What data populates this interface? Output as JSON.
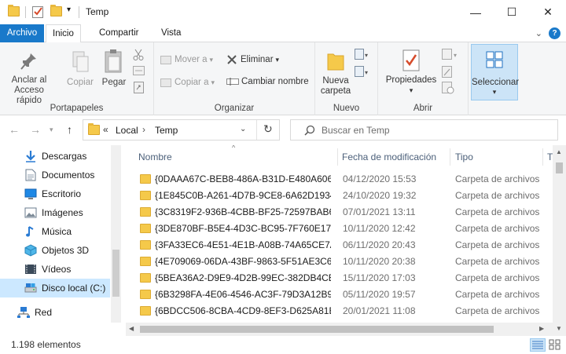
{
  "window": {
    "title": "Temp",
    "minimize": "—",
    "maximize": "☐",
    "close": "✕"
  },
  "quick_access": {
    "dropdown": "▾"
  },
  "tabs": [
    {
      "label": "Archivo"
    },
    {
      "label": "Inicio"
    },
    {
      "label": "Compartir"
    },
    {
      "label": "Vista"
    }
  ],
  "tabs_right": {
    "collapse": "⌄",
    "help": "?"
  },
  "ribbon": {
    "portapapeles": {
      "label": "Portapapeles",
      "anclar": "Anclar al",
      "anclar2": "Acceso rápido",
      "copiar": "Copiar",
      "pegar": "Pegar"
    },
    "organizar": {
      "label": "Organizar",
      "mover": "Mover a",
      "copiar_a": "Copiar a",
      "eliminar": "Eliminar",
      "cambiar": "Cambiar nombre"
    },
    "nuevo": {
      "label": "Nuevo",
      "nueva": "Nueva",
      "carpeta": "carpeta"
    },
    "abrir": {
      "label": "Abrir",
      "propiedades": "Propiedades"
    },
    "seleccionar": {
      "label": "Seleccionar"
    }
  },
  "address": {
    "breadcrumb_prefix": "«",
    "crumb1": "Local",
    "sep": "›",
    "crumb2": "Temp",
    "search_placeholder": "Buscar en Temp"
  },
  "nav": [
    {
      "label": "Descargas",
      "icon": "download-icon"
    },
    {
      "label": "Documentos",
      "icon": "document-icon"
    },
    {
      "label": "Escritorio",
      "icon": "desktop-icon"
    },
    {
      "label": "Imágenes",
      "icon": "image-icon"
    },
    {
      "label": "Música",
      "icon": "music-icon"
    },
    {
      "label": "Objetos 3D",
      "icon": "cube-icon"
    },
    {
      "label": "Vídeos",
      "icon": "video-icon"
    },
    {
      "label": "Disco local (C:)",
      "icon": "drive-icon",
      "selected": true
    },
    {
      "label": "Red",
      "icon": "network-icon"
    }
  ],
  "columns": {
    "name": "Nombre",
    "date": "Fecha de modificación",
    "type": "Tipo",
    "extra": "T"
  },
  "files": [
    {
      "name": "{0DAAA67C-BEB8-486A-B31D-E480A6068",
      "date": "04/12/2020 15:53",
      "type": "Carpeta de archivos"
    },
    {
      "name": "{1E845C0B-A261-4D7B-9CE8-6A62D1934",
      "date": "24/10/2020 19:32",
      "type": "Carpeta de archivos"
    },
    {
      "name": "{3C8319F2-936B-4CBB-BF25-72597BAB6",
      "date": "07/01/2021 13:11",
      "type": "Carpeta de archivos"
    },
    {
      "name": "{3DE870BF-B5E4-4D3C-BC95-7F760E173B",
      "date": "10/11/2020 12:42",
      "type": "Carpeta de archivos"
    },
    {
      "name": "{3FA33EC6-4E51-4E1B-A08B-74A65CE7A9",
      "date": "06/11/2020 20:43",
      "type": "Carpeta de archivos"
    },
    {
      "name": "{4E709069-06DA-43BF-9863-5F51AE3C64",
      "date": "10/11/2020 20:38",
      "type": "Carpeta de archivos"
    },
    {
      "name": "{5BEA36A2-D9E9-4D2B-99EC-382DB4CE5",
      "date": "15/11/2020 17:03",
      "type": "Carpeta de archivos"
    },
    {
      "name": "{6B3298FA-4E06-4546-AC3F-79D3A12B9F",
      "date": "05/11/2020 19:57",
      "type": "Carpeta de archivos"
    },
    {
      "name": "{6BDCC506-8CBA-4CD9-8EF3-D625A81E",
      "date": "20/01/2021 11:08",
      "type": "Carpeta de archivos"
    },
    {
      "name": "",
      "date": "",
      "type": ""
    }
  ],
  "status": {
    "count": "1.198 elementos"
  }
}
